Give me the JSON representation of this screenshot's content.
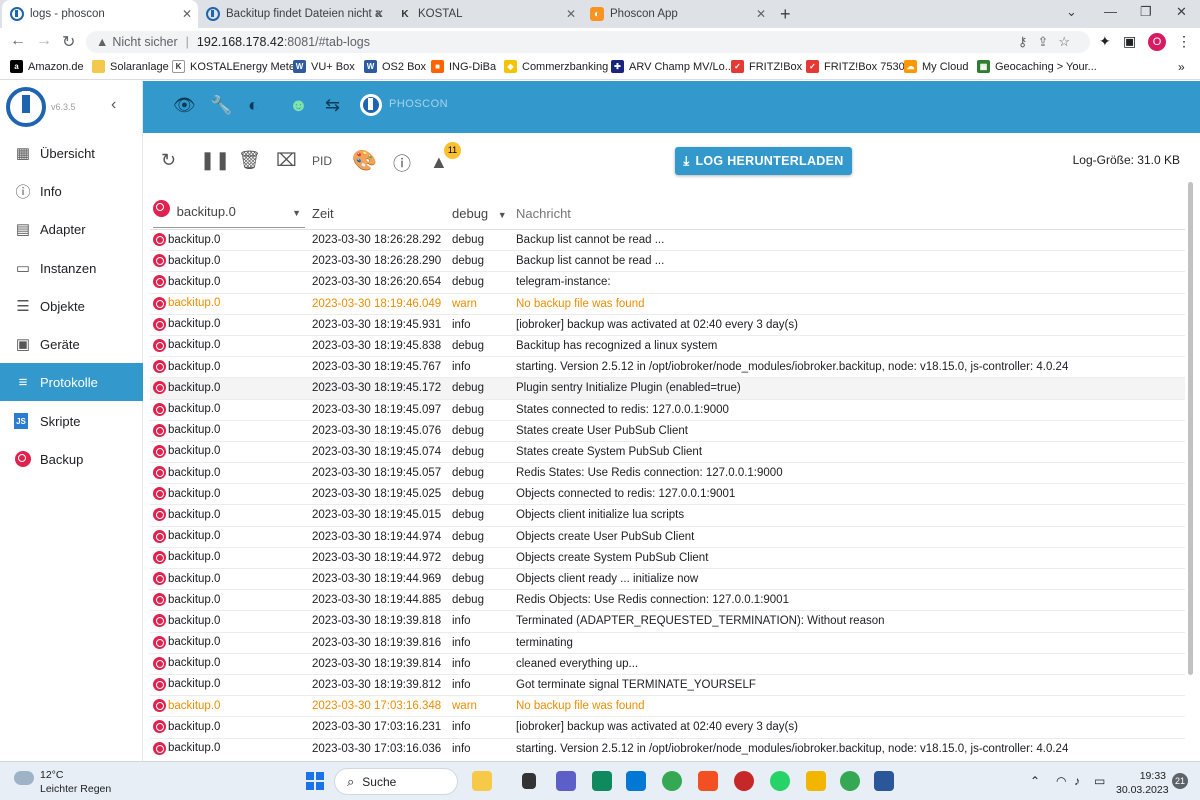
{
  "browser": {
    "tabs": [
      {
        "title": "logs - phoscon",
        "active": true
      },
      {
        "title": "Backitup findet Dateien nicht au",
        "active": false
      },
      {
        "title": "KOSTAL",
        "active": false
      },
      {
        "title": "Phoscon App",
        "active": false
      }
    ],
    "address": {
      "security_label": "Nicht sicher",
      "host": "192.168.178.42",
      "path": ":8081/#tab-logs"
    },
    "bookmarks": [
      {
        "label": "Amazon.de",
        "icon": "amazon-icon",
        "color": "#000000"
      },
      {
        "label": "Solaranlage",
        "icon": "folder-icon",
        "color": "#f2c94c"
      },
      {
        "label": "KOSTALEnergy Meter",
        "icon": "kostal-icon",
        "color": "#333333"
      },
      {
        "label": "VU+ Box",
        "icon": "vu-icon",
        "color": "#2d5aa0"
      },
      {
        "label": "OS2 Box",
        "icon": "vu-icon",
        "color": "#2d5aa0"
      },
      {
        "label": "ING-DiBa",
        "icon": "ing-icon",
        "color": "#ff6200"
      },
      {
        "label": "Commerzbanking",
        "icon": "commerzbank-icon",
        "color": "#f5c400"
      },
      {
        "label": "ARV Champ MV/Lo...",
        "icon": "arv-icon",
        "color": "#1a237e"
      },
      {
        "label": "FRITZ!Box",
        "icon": "fritz-icon",
        "color": "#e53935"
      },
      {
        "label": "FRITZ!Box 7530",
        "icon": "fritz-icon",
        "color": "#e53935"
      },
      {
        "label": "My Cloud",
        "icon": "cloud-icon",
        "color": "#ff9800"
      },
      {
        "label": "Geocaching > Your...",
        "icon": "geocaching-icon",
        "color": "#2e7d32"
      }
    ],
    "profile_initial": "O"
  },
  "sidebar": {
    "version": "v6.3.5",
    "items": [
      {
        "label": "Übersicht",
        "icon": "grid-icon",
        "glyph": "▦",
        "color": "#555555",
        "active": false
      },
      {
        "label": "Info",
        "icon": "info-icon",
        "glyph": "ⓘ",
        "color": "#555555",
        "active": false
      },
      {
        "label": "Adapter",
        "icon": "store-icon",
        "glyph": "▤",
        "color": "#555555",
        "active": false
      },
      {
        "label": "Instanzen",
        "icon": "instances-icon",
        "glyph": "▭",
        "color": "#555555",
        "active": false
      },
      {
        "label": "Objekte",
        "icon": "list-icon",
        "glyph": "☰",
        "color": "#555555",
        "active": false
      },
      {
        "label": "Geräte",
        "icon": "devices-icon",
        "glyph": "▣",
        "color": "#555555",
        "active": false
      },
      {
        "label": "Protokolle",
        "icon": "logs-icon",
        "glyph": "≡",
        "color": "#ffffff",
        "active": true
      },
      {
        "label": "Skripte",
        "icon": "javascript-icon",
        "glyph": "JS",
        "color": "#2a7dd1",
        "active": false
      },
      {
        "label": "Backup",
        "icon": "backup-icon",
        "glyph": "◷",
        "color": "#e0234e",
        "active": false
      }
    ]
  },
  "toolbar": {
    "pid_label": "PID",
    "warnings_count": "11",
    "download_label": "LOG HERUNTERLADEN",
    "log_size": "Log-Größe: 31.0 KB"
  },
  "table": {
    "source_filter": "backitup.0",
    "time_header": "Zeit",
    "severity_filter": "debug",
    "message_placeholder": "Nachricht",
    "rows": [
      {
        "source": "backitup.0",
        "time": "2023-03-30 18:26:28.292",
        "severity": "debug",
        "message": "Backup list cannot be read ..."
      },
      {
        "source": "backitup.0",
        "time": "2023-03-30 18:26:28.290",
        "severity": "debug",
        "message": "Backup list cannot be read ..."
      },
      {
        "source": "backitup.0",
        "time": "2023-03-30 18:26:20.654",
        "severity": "debug",
        "message": "telegram-instance:"
      },
      {
        "source": "backitup.0",
        "time": "2023-03-30 18:19:46.049",
        "severity": "warn",
        "message": "No backup file was found"
      },
      {
        "source": "backitup.0",
        "time": "2023-03-30 18:19:45.931",
        "severity": "info",
        "message": "[iobroker] backup was activated at 02:40 every 3 day(s)"
      },
      {
        "source": "backitup.0",
        "time": "2023-03-30 18:19:45.838",
        "severity": "debug",
        "message": "Backitup has recognized a linux system"
      },
      {
        "source": "backitup.0",
        "time": "2023-03-30 18:19:45.767",
        "severity": "info",
        "message": "starting. Version 2.5.12 in /opt/iobroker/node_modules/iobroker.backitup, node: v18.15.0, js-controller: 4.0.24"
      },
      {
        "source": "backitup.0",
        "time": "2023-03-30 18:19:45.172",
        "severity": "debug",
        "message": "Plugin sentry Initialize Plugin (enabled=true)"
      },
      {
        "source": "backitup.0",
        "time": "2023-03-30 18:19:45.097",
        "severity": "debug",
        "message": "States connected to redis: 127.0.0.1:9000"
      },
      {
        "source": "backitup.0",
        "time": "2023-03-30 18:19:45.076",
        "severity": "debug",
        "message": "States create User PubSub Client"
      },
      {
        "source": "backitup.0",
        "time": "2023-03-30 18:19:45.074",
        "severity": "debug",
        "message": "States create System PubSub Client"
      },
      {
        "source": "backitup.0",
        "time": "2023-03-30 18:19:45.057",
        "severity": "debug",
        "message": "Redis States: Use Redis connection: 127.0.0.1:9000"
      },
      {
        "source": "backitup.0",
        "time": "2023-03-30 18:19:45.025",
        "severity": "debug",
        "message": "Objects connected to redis: 127.0.0.1:9001"
      },
      {
        "source": "backitup.0",
        "time": "2023-03-30 18:19:45.015",
        "severity": "debug",
        "message": "Objects client initialize lua scripts"
      },
      {
        "source": "backitup.0",
        "time": "2023-03-30 18:19:44.974",
        "severity": "debug",
        "message": "Objects create User PubSub Client"
      },
      {
        "source": "backitup.0",
        "time": "2023-03-30 18:19:44.972",
        "severity": "debug",
        "message": "Objects create System PubSub Client"
      },
      {
        "source": "backitup.0",
        "time": "2023-03-30 18:19:44.969",
        "severity": "debug",
        "message": "Objects client ready ... initialize now"
      },
      {
        "source": "backitup.0",
        "time": "2023-03-30 18:19:44.885",
        "severity": "debug",
        "message": "Redis Objects: Use Redis connection: 127.0.0.1:9001"
      },
      {
        "source": "backitup.0",
        "time": "2023-03-30 18:19:39.818",
        "severity": "info",
        "message": "Terminated (ADAPTER_REQUESTED_TERMINATION): Without reason"
      },
      {
        "source": "backitup.0",
        "time": "2023-03-30 18:19:39.816",
        "severity": "info",
        "message": "terminating"
      },
      {
        "source": "backitup.0",
        "time": "2023-03-30 18:19:39.814",
        "severity": "info",
        "message": "cleaned everything up..."
      },
      {
        "source": "backitup.0",
        "time": "2023-03-30 18:19:39.812",
        "severity": "info",
        "message": "Got terminate signal TERMINATE_YOURSELF"
      },
      {
        "source": "backitup.0",
        "time": "2023-03-30 17:03:16.348",
        "severity": "warn",
        "message": "No backup file was found"
      },
      {
        "source": "backitup.0",
        "time": "2023-03-30 17:03:16.231",
        "severity": "info",
        "message": "[iobroker] backup was activated at 02:40 every 3 day(s)"
      },
      {
        "source": "backitup.0",
        "time": "2023-03-30 17:03:16.036",
        "severity": "info",
        "message": "starting. Version 2.5.12 in /opt/iobroker/node_modules/iobroker.backitup, node: v18.15.0, js-controller: 4.0.24"
      }
    ],
    "warn_color": "#f08c00",
    "highlighted_row": 7
  },
  "taskbar": {
    "temperature": "12°C",
    "weather": "Leichter Regen",
    "search_label": "Suche",
    "time": "19:33",
    "date": "30.03.2023",
    "notifications": "21"
  },
  "colors": {
    "appbar": "#3399cc",
    "active_nav": "#3399cc",
    "brand": "#1e64b0",
    "backup_red": "#e0234e"
  }
}
